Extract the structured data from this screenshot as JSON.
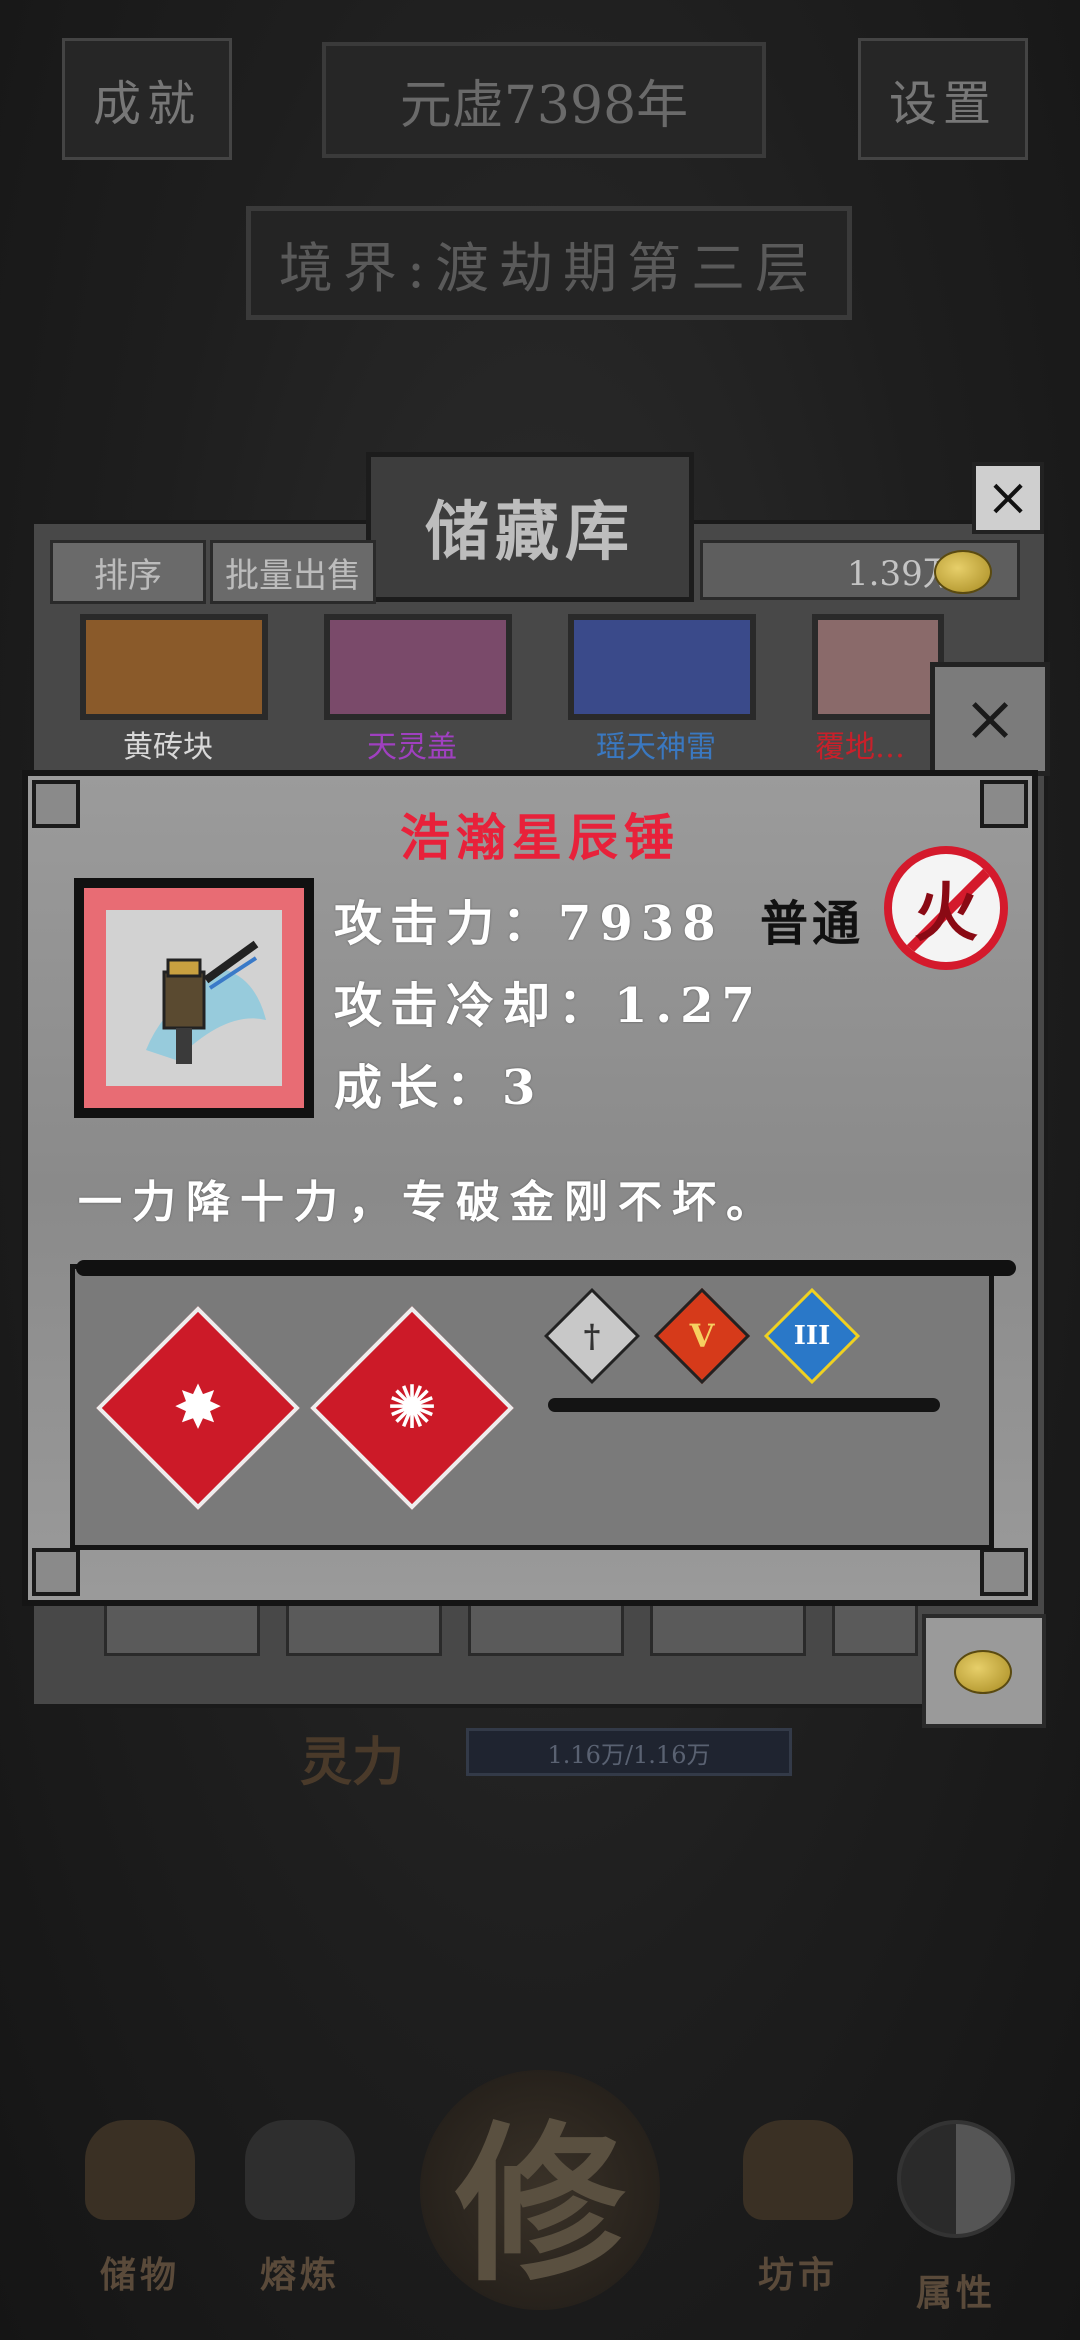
{
  "header": {
    "achievement_label": "成就",
    "year_label": "元虚7398年",
    "settings_label": "设置",
    "realm_label": "境界:渡劫期第三层"
  },
  "storage": {
    "title": "储藏库",
    "close_glyph": "×",
    "sort_label": "排序",
    "batch_sell_label": "批量出售",
    "coins": "1.39万",
    "slots": [
      {
        "name": "黄砖块",
        "color": "#d8d8d8"
      },
      {
        "name": "天灵盖",
        "color": "#a040c0"
      },
      {
        "name": "瑶天神雷",
        "color": "#3a78c0"
      },
      {
        "name": "覆地…",
        "color": "#c8202a"
      }
    ],
    "slot_close_glyph": "×",
    "lingli_label": "灵力",
    "lingli_value": "1.16万/1.16万"
  },
  "item": {
    "name": "浩瀚星辰锤",
    "name_color": "#e8213a",
    "icon": "star-hammer-icon",
    "attack_line": "攻击力：7938",
    "cooldown_line": "攻击冷却：1.27",
    "growth_line": "成长：3",
    "rarity": "普通",
    "element_glyph": "火",
    "description": "一力降十力，专破金刚不坏。",
    "skills": [
      {
        "icon": "hammer-burst-icon",
        "glyph": "✸"
      },
      {
        "icon": "shockwave-icon",
        "glyph": "✺"
      }
    ],
    "badges": [
      {
        "icon": "sword-badge-icon",
        "glyph": "†",
        "color": "#c8c8c8",
        "text_color": "#333"
      },
      {
        "icon": "rank-v-badge-icon",
        "glyph": "V",
        "color": "#d63a1a",
        "text_color": "#f6d060"
      },
      {
        "icon": "rank-iii-badge-icon",
        "glyph": "III",
        "color": "#2a78c8",
        "text_color": "#ffffff"
      }
    ]
  },
  "nav": {
    "storage_label": "储物",
    "smelt_label": "熔炼",
    "cultivate_glyph": "修",
    "market_label": "坊市",
    "attribute_label": "属性"
  }
}
